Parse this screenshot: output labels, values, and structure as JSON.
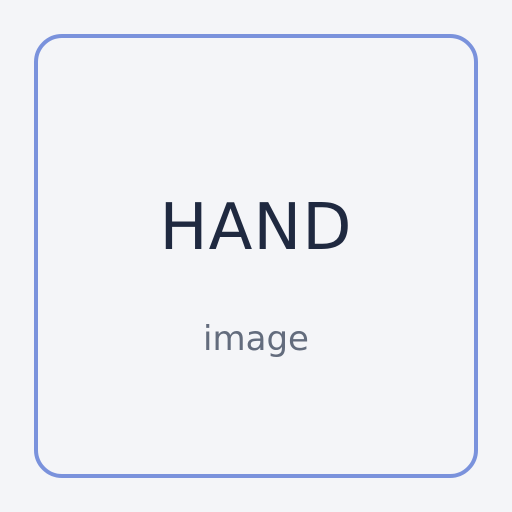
{
  "card": {
    "title": "HAND",
    "subtitle": "image"
  },
  "colors": {
    "background": "#f4f5f8",
    "border": "#7a92dc",
    "title_text": "#1f2940",
    "subtitle_text": "#636c7d"
  }
}
